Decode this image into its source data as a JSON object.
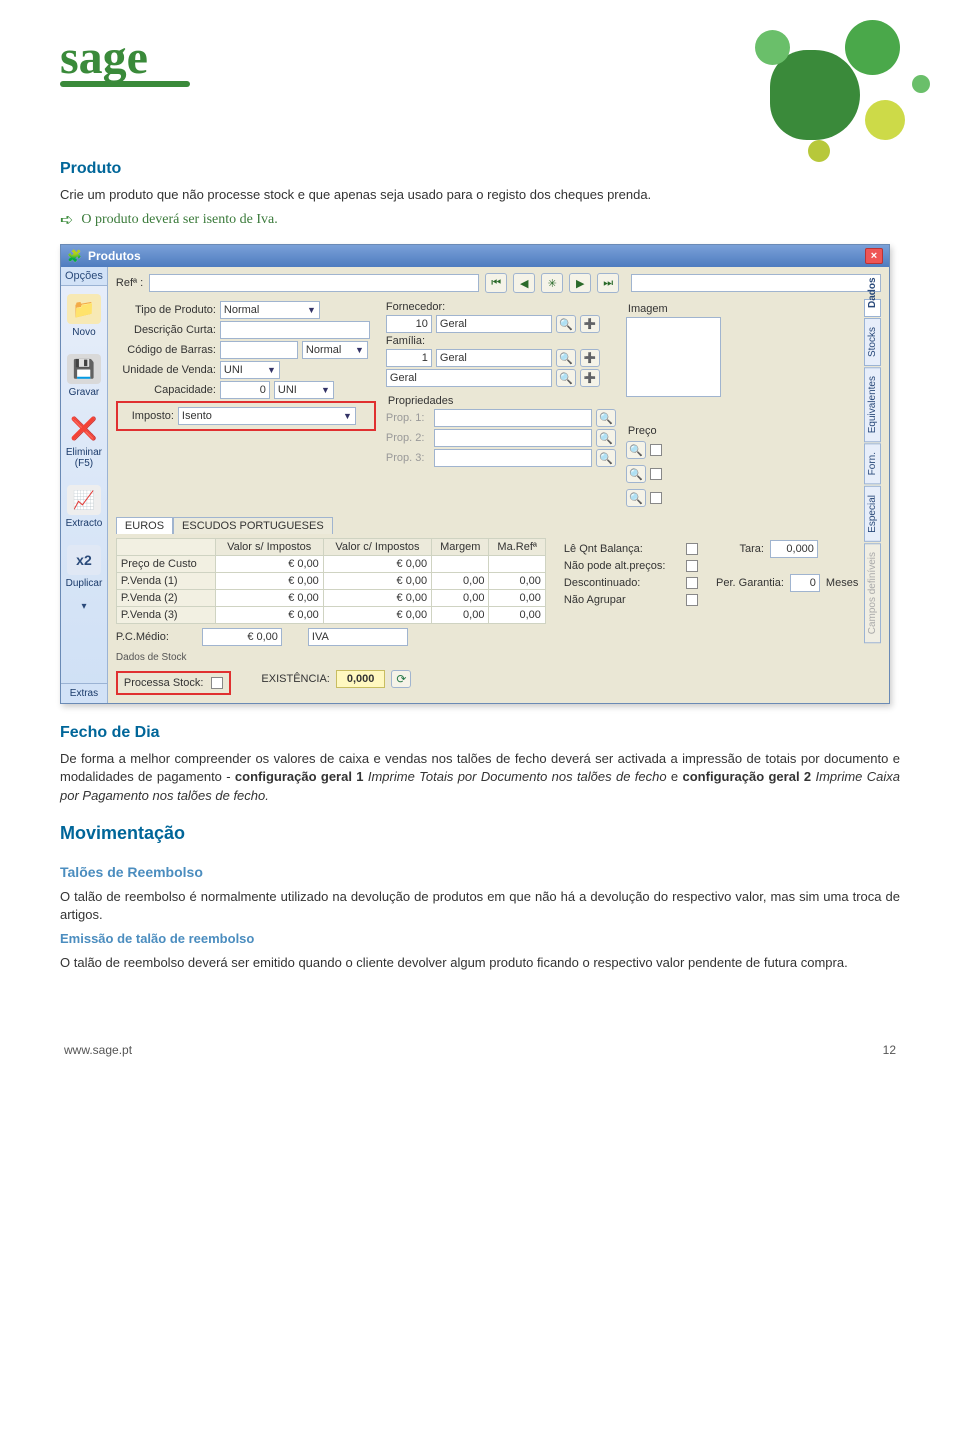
{
  "sections": {
    "produto_h": "Produto",
    "produto_p": "Crie um produto que não processe stock e que apenas seja usado para o registo dos cheques prenda.",
    "produto_note": "O produto deverá ser isento de Iva.",
    "fecho_h": "Fecho de Dia",
    "fecho_p1a": "De forma a melhor compreender os valores de caixa e vendas nos talões de fecho deverá ser activada a impressão de totais por documento e modalidades de pagamento - ",
    "fecho_cfg1": "configuração geral 1",
    "fecho_i1": " Imprime Totais por Documento nos talões de fecho",
    "fecho_e": " e ",
    "fecho_cfg2": "configuração geral 2",
    "fecho_i2": " Imprime Caixa por Pagamento nos talões de fecho.",
    "mov_h": "Movimentação",
    "tr_h": "Talões de Reembolso",
    "tr_p": "O talão de reembolso é normalmente utilizado na devolução de produtos em que não há a devolução do respectivo valor, mas sim uma troca de artigos.",
    "etr_h": "Emissão de talão de reembolso",
    "etr_p": "O talão de reembolso deverá ser emitido quando o cliente devolver algum produto ficando o respectivo valor pendente de futura compra."
  },
  "footer": {
    "url": "www.sage.pt",
    "page": "12"
  },
  "win": {
    "title": "Produtos",
    "sidebar": {
      "opcoes": "Opções",
      "novo": "Novo",
      "gravar": "Gravar",
      "eliminar": "Eliminar (F5)",
      "extracto": "Extracto",
      "duplicar": "Duplicar",
      "extras": "Extras"
    },
    "search": {
      "ref_label": "Refª :"
    },
    "fields": {
      "tipo_l": "Tipo de Produto:",
      "tipo_v": "Normal",
      "desc_l": "Descrição Curta:",
      "cod_l": "Código de Barras:",
      "cod_sel": "Normal",
      "uni_l": "Unidade de Venda:",
      "uni_v": "UNI",
      "cap_l": "Capacidade:",
      "cap_v": "0",
      "cap_sel": "UNI",
      "imp_l": "Imposto:",
      "imp_v": "Isento",
      "forn_l": "Fornecedor:",
      "forn_n": "10",
      "forn_t": "Geral",
      "fam_l": "Família:",
      "fam_n": "1",
      "fam_t": "Geral",
      "sub_t": "Geral",
      "prop_h": "Propriedades",
      "p1": "Prop. 1:",
      "p2": "Prop. 2:",
      "p3": "Prop. 3:",
      "img_h": "Imagem",
      "preco_h": "Preço"
    },
    "tabs": {
      "euros": "EUROS",
      "escudos": "ESCUDOS PORTUGUESES"
    },
    "table": {
      "h_vs": "Valor s/ Impostos",
      "h_vc": "Valor c/ Impostos",
      "h_mar": "Margem",
      "h_ma": "Ma.Refª",
      "r0": "Preço de Custo",
      "r1": "P.Venda (1)",
      "r2": "P.Venda (2)",
      "r3": "P.Venda (3)",
      "val_e": "€ 0,00",
      "val_0": "0,00"
    },
    "pc": {
      "lbl": "P.C.Médio:",
      "val": "€ 0,00",
      "iva": "IVA"
    },
    "stats": {
      "leqnt": "Lê Qnt Balança:",
      "noalt": "Não pode alt.preços:",
      "desc": "Descontinuado:",
      "noagr": "Não Agrupar",
      "tara_l": "Tara:",
      "tara_v": "0,000",
      "garan_l": "Per. Garantia:",
      "garan_v": "0",
      "garan_u": "Meses"
    },
    "stock": {
      "dados": "Dados de Stock",
      "proc": "Processa Stock:",
      "exist_l": "EXISTÊNCIA:",
      "exist_v": "0,000"
    },
    "vtabs": {
      "dados": "Dados",
      "stocks": "Stocks",
      "equiv": "Equivalentes",
      "forn": "Forn.",
      "esp": "Especial",
      "cdef": "Campos definíveis"
    }
  }
}
